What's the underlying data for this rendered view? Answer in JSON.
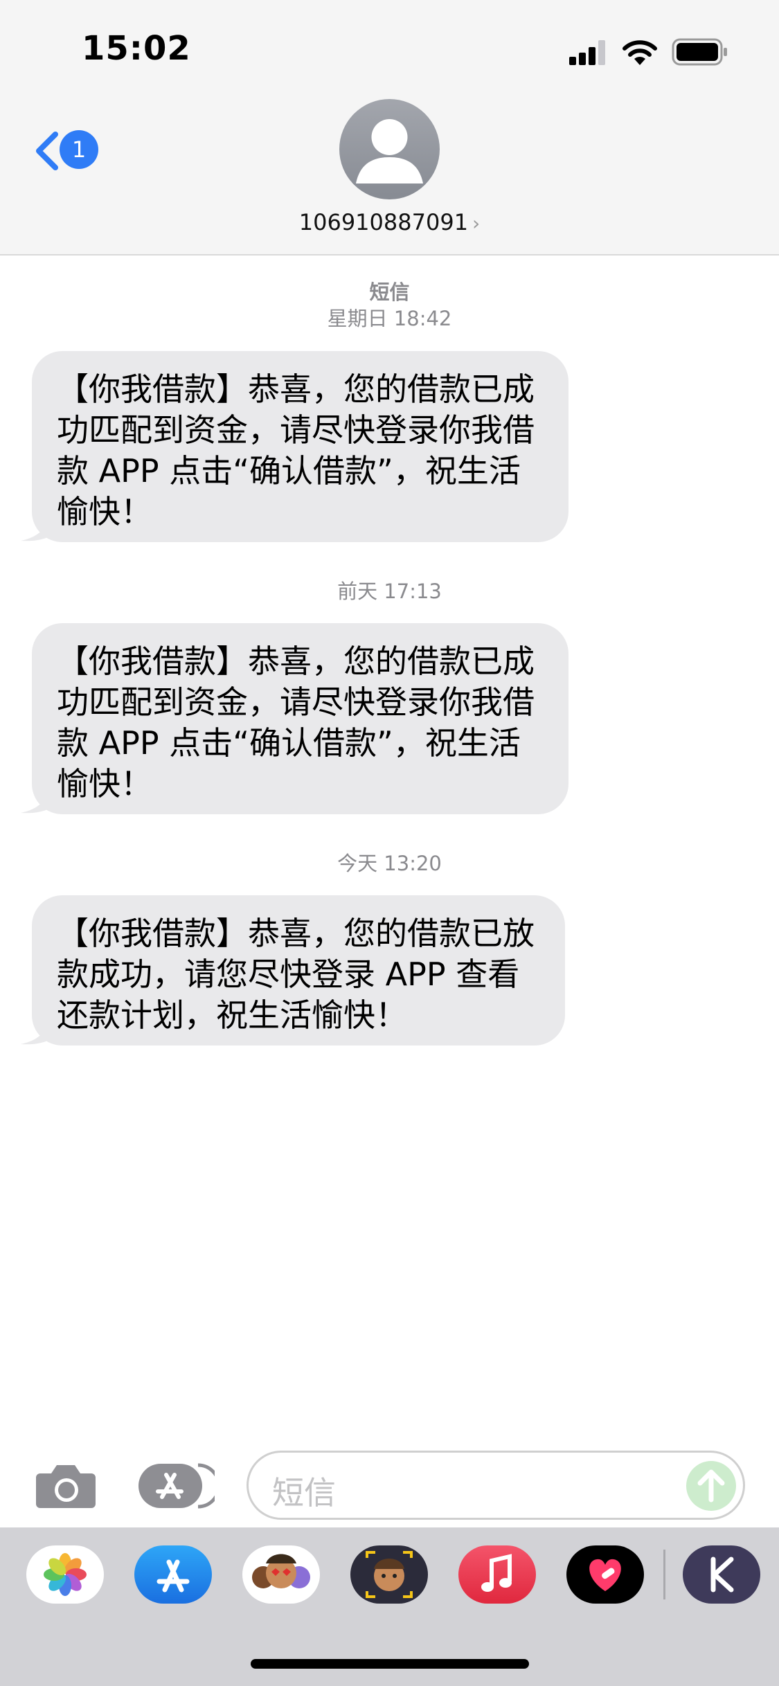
{
  "status": {
    "time": "15:02"
  },
  "header": {
    "back_badge": "1",
    "contact": "106910887091",
    "chevron": "›"
  },
  "thread": {
    "service": "短信",
    "groups": [
      {
        "timestamp": "星期日 18:42",
        "message": "【你我借款】恭喜，您的借款已成功匹配到资金，请尽快登录你我借款 APP 点击“确认借款”，祝生活愉快！"
      },
      {
        "timestamp": "前天 17:13",
        "message": "【你我借款】恭喜，您的借款已成功匹配到资金，请尽快登录你我借款 APP 点击“确认借款”，祝生活愉快！"
      },
      {
        "timestamp": "今天 13:20",
        "message": "【你我借款】恭喜，您的借款已放款成功，请您尽快登录 APP 查看还款计划，祝生活愉快！"
      }
    ]
  },
  "composer": {
    "placeholder": "短信"
  },
  "icons": [
    "camera-icon",
    "app-store-icon",
    "photos-icon",
    "appstore-app-icon",
    "memoji-stickers-icon",
    "memoji-icon",
    "music-icon",
    "heart-app-icon",
    "k-app-icon"
  ],
  "colors": {
    "accent": "#2f7cf6",
    "bubble": "#e9e9eb",
    "header": "#f5f5f5",
    "tray": "#d2d2d6"
  }
}
